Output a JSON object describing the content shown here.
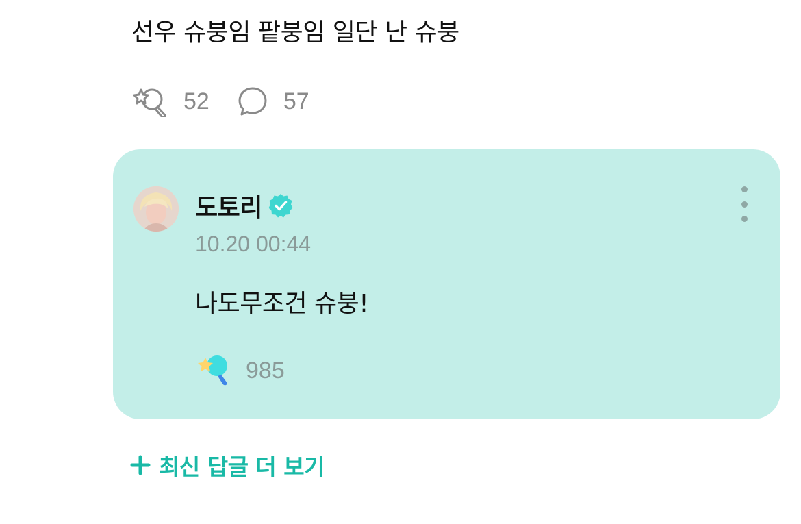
{
  "post": {
    "text": "선우 슈붕임 팥붕임 일단 난 슈붕",
    "like_count": "52",
    "comment_count": "57"
  },
  "reply": {
    "author": "도토리",
    "timestamp": "10.20 00:44",
    "text": "나도무조건 슈붕!",
    "like_count": "985"
  },
  "more_replies_label": "최신 답글 더 보기",
  "colors": {
    "card_background": "#c3eee8",
    "accent": "#19b9a6",
    "verified": "#3ed6d0",
    "muted_text": "#8a8a8a"
  },
  "icons": {
    "post_like": "lightstick-outline-icon",
    "post_comment": "speech-bubble-icon",
    "verified": "verified-badge-icon",
    "reply_like": "lightstick-filled-icon",
    "more": "more-vertical-icon",
    "plus": "plus-icon"
  }
}
